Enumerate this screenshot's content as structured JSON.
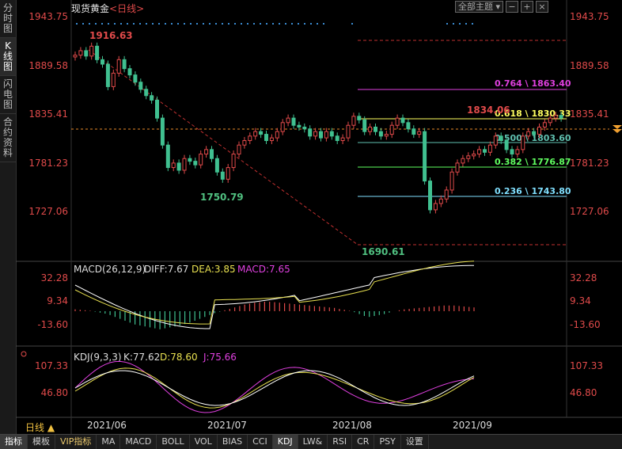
{
  "sidebar": [
    {
      "label": "分时图",
      "active": false
    },
    {
      "label": "K线图",
      "active": true
    },
    {
      "label": "闪电图",
      "active": false
    },
    {
      "label": "合约资料",
      "active": false
    }
  ],
  "header": {
    "instrument": "现货黄金",
    "period": "<日线>"
  },
  "toolbar": {
    "dropdown": "全部主题 ▾",
    "btn_minus": "−",
    "btn_plus": "+",
    "btn_close": "×"
  },
  "price_axis": [
    "1943.75",
    "1889.58",
    "1835.41",
    "1781.23",
    "1727.06"
  ],
  "annotations": {
    "high": "1916.63",
    "low1": "1750.79",
    "low2": "1690.61",
    "recent_high": "1834.06"
  },
  "fib_levels": [
    {
      "label": "0.764 \\ 1863.40",
      "color": "#e040e0"
    },
    {
      "label": "0.618 \\ 1830.33",
      "color": "#ffff60"
    },
    {
      "label": "0.500 \\ 1803.60",
      "color": "#60c0b0"
    },
    {
      "label": "0.382 \\ 1776.87",
      "color": "#60ff60"
    },
    {
      "label": "0.236 \\ 1743.80",
      "color": "#80e0ff"
    }
  ],
  "macd": {
    "title": "MACD(26,12,9)",
    "diff": "DIFF:7.67",
    "dea": "DEA:3.85",
    "macd": "MACD:7.65",
    "axis": [
      "32.28",
      "9.34",
      "-13.60"
    ]
  },
  "kdj": {
    "title": "KDJ(9,3,3)",
    "k": "K:77.62",
    "d": "D:78.60",
    "j": "J:75.66",
    "axis": [
      "107.33",
      "46.80"
    ]
  },
  "dates": [
    "2021/06",
    "2021/07",
    "2021/08",
    "2021/09"
  ],
  "period_label": "日线 ▲",
  "bottom_tabs": [
    {
      "label": "指标",
      "active": true,
      "vip": false
    },
    {
      "label": "模板",
      "active": false,
      "vip": false
    },
    {
      "label": "VIP指标",
      "active": false,
      "vip": true
    },
    {
      "label": "MA",
      "active": false,
      "vip": false
    },
    {
      "label": "MACD",
      "active": false,
      "vip": false
    },
    {
      "label": "BOLL",
      "active": false,
      "vip": false
    },
    {
      "label": "VOL",
      "active": false,
      "vip": false
    },
    {
      "label": "BIAS",
      "active": false,
      "vip": false
    },
    {
      "label": "CCI",
      "active": false,
      "vip": false
    },
    {
      "label": "KDJ",
      "active": true,
      "vip": false
    },
    {
      "label": "LW&",
      "active": false,
      "vip": false
    },
    {
      "label": "RSI",
      "active": false,
      "vip": false
    },
    {
      "label": "CR",
      "active": false,
      "vip": false
    },
    {
      "label": "PSY",
      "active": false,
      "vip": false
    },
    {
      "label": "设置",
      "active": false,
      "vip": false
    }
  ]
}
